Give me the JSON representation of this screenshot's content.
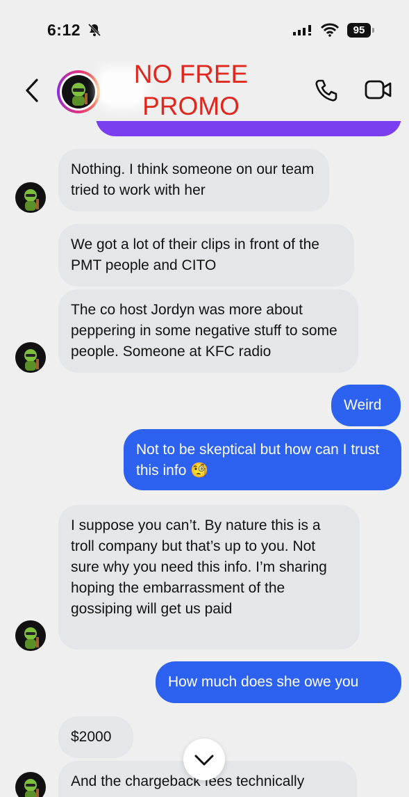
{
  "status_bar": {
    "time": "6:12",
    "battery": "95"
  },
  "header": {
    "redaction_text": "NO FREE\nPROMO"
  },
  "messages": [
    {
      "side": "received",
      "text": "Nothing. I think someone on our team tried to work with her"
    },
    {
      "side": "received",
      "text": "We got a lot of their clips in front of the PMT people and CITO"
    },
    {
      "side": "received",
      "text": "The co host Jordyn was more about peppering in some negative stuff to some people. Someone at KFC radio"
    },
    {
      "side": "sent",
      "text": "Weird"
    },
    {
      "side": "sent",
      "text": "Not to be skeptical but how can I trust this info 🧐"
    },
    {
      "side": "received",
      "text": "I suppose you can’t. By nature this is a troll company but that’s up to you. Not sure why you need this info. I’m sharing hoping the embarrassment of the gossiping will get us paid"
    },
    {
      "side": "sent",
      "text": "How much does she owe you"
    },
    {
      "side": "received",
      "text": "$2000"
    },
    {
      "side": "received",
      "text": "And the chargeback fees technically"
    }
  ],
  "icons": {
    "back": "chevron-left-icon",
    "phone": "phone-icon",
    "video": "video-camera-icon",
    "scroll": "chevron-down-icon",
    "bell": "bell-slash-icon"
  },
  "colors": {
    "sent_bubble": "#2d62f0",
    "received_bubble": "#e4e6ea",
    "redaction_text": "#e0271e",
    "partial_bubble": "#7b3ff2"
  }
}
